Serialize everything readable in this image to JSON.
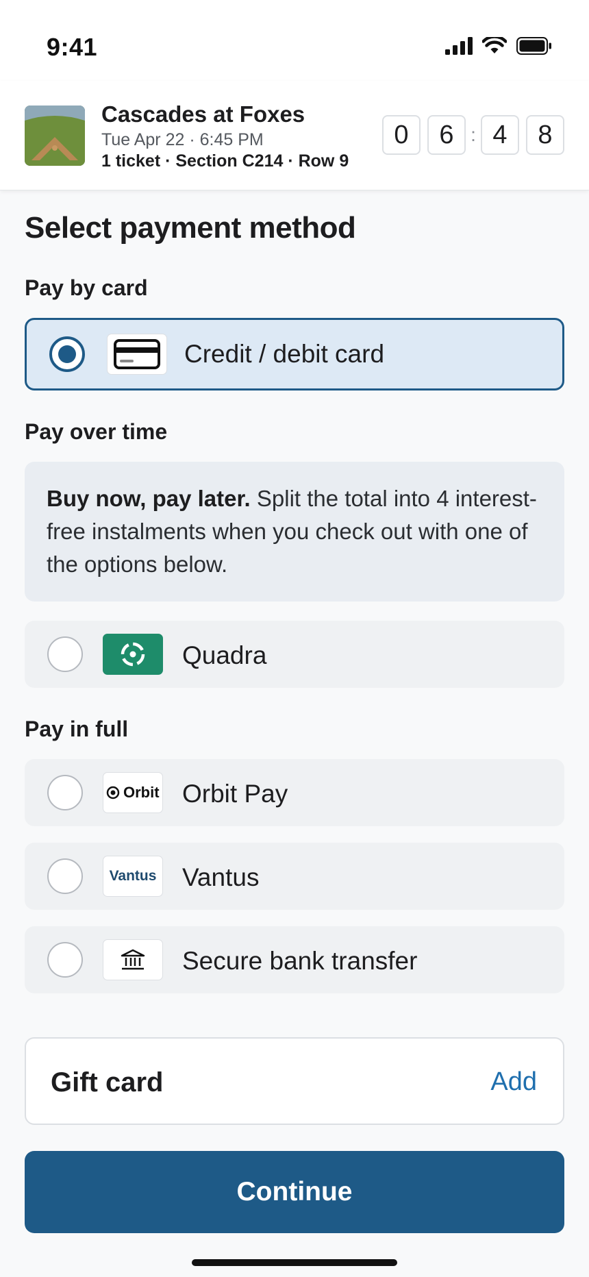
{
  "status_bar": {
    "time": "9:41"
  },
  "event": {
    "title": "Cascades at Foxes",
    "date_time": "Tue Apr 22 · 6:45 PM",
    "seat_info": "1 ticket · Section C214 · Row 9",
    "timer": {
      "d1": "0",
      "d2": "6",
      "separator": ":",
      "d3": "4",
      "d4": "8"
    }
  },
  "page_title": "Select payment method",
  "sections": {
    "card": {
      "label": "Pay by card",
      "option": {
        "label": "Credit / debit card",
        "selected": true,
        "icon": "credit-card-icon"
      }
    },
    "over_time": {
      "label": "Pay over time",
      "info_bold": "Buy now, pay later.",
      "info_text": " Split the total into 4 interest-free instalments when you check out with one of the options below.",
      "option": {
        "label": "Quadra",
        "selected": false,
        "icon": "quadra-logo",
        "brand_color": "#1e8c6a"
      }
    },
    "in_full": {
      "label": "Pay in full",
      "options": [
        {
          "label": "Orbit Pay",
          "logo_text": "Orbit",
          "selected": false
        },
        {
          "label": "Vantus",
          "logo_text": "Vantus",
          "selected": false,
          "brand_color": "#1e4a6e"
        },
        {
          "label": "Secure bank transfer",
          "selected": false,
          "icon": "bank-icon"
        }
      ]
    }
  },
  "gift_card": {
    "label": "Gift card",
    "action": "Add"
  },
  "continue_label": "Continue",
  "colors": {
    "primary": "#1e5a87",
    "link": "#1f6fae",
    "selected_bg": "#dde9f5"
  }
}
